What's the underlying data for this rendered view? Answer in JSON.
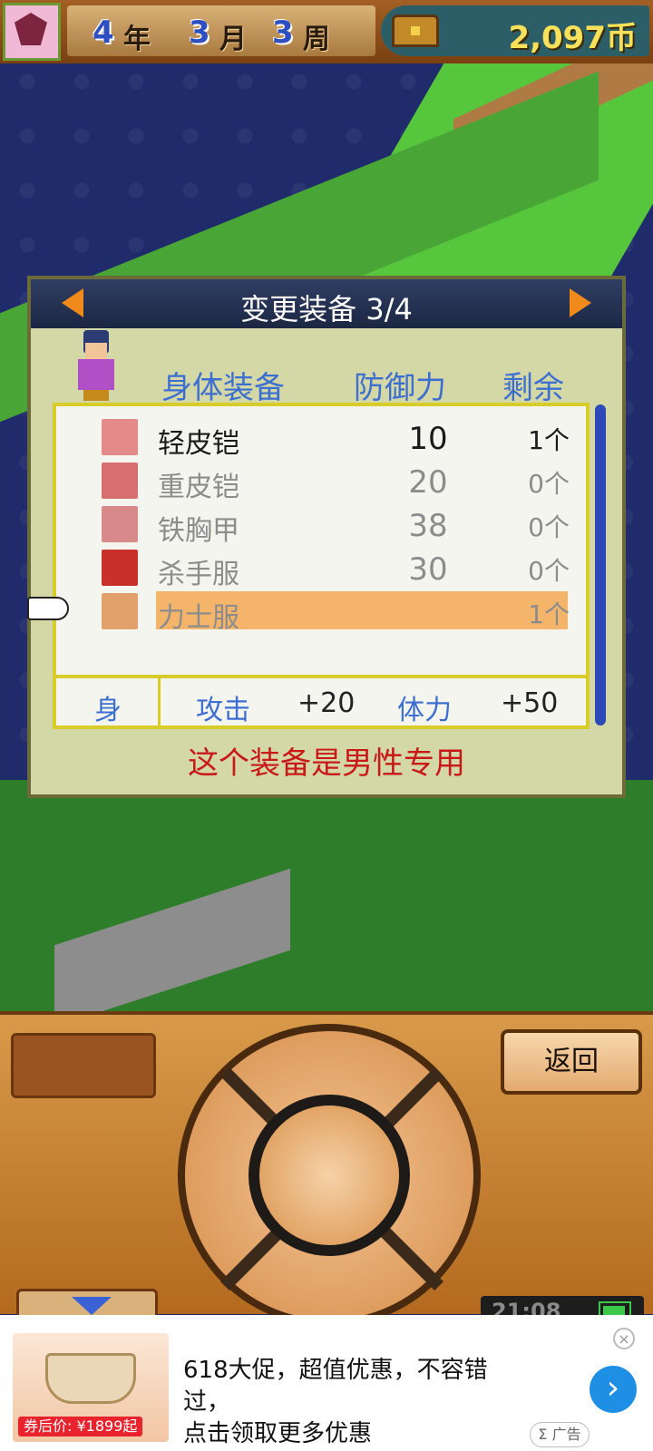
{
  "header": {
    "year": "4",
    "year_unit": "年",
    "month": "3",
    "month_unit": "月",
    "week": "3",
    "week_unit": "周",
    "coins": "2,097币"
  },
  "dialog": {
    "title": "变更装备 3/4",
    "columns": {
      "slot": "身体装备",
      "defense": "防御力",
      "remaining": "剩余"
    },
    "items": [
      {
        "name": "轻皮铠",
        "defense": "10",
        "count": "1个",
        "icon": "light-leather-armor-icon",
        "state": "available"
      },
      {
        "name": "重皮铠",
        "defense": "20",
        "count": "0个",
        "icon": "heavy-leather-armor-icon",
        "state": "unavailable"
      },
      {
        "name": "铁胸甲",
        "defense": "38",
        "count": "0个",
        "icon": "iron-breastplate-icon",
        "state": "unavailable"
      },
      {
        "name": "杀手服",
        "defense": "30",
        "count": "0个",
        "icon": "assassin-outfit-icon",
        "state": "unavailable"
      },
      {
        "name": "力士服",
        "defense": "",
        "count": "1个",
        "icon": "strongman-outfit-icon",
        "state": "selected"
      }
    ],
    "stats": {
      "slot": "身",
      "stat1_label": "攻击",
      "stat1_value": "+20",
      "stat2_label": "体力",
      "stat2_value": "+50"
    },
    "notice": "这个装备是男性专用"
  },
  "controls": {
    "back_label": "返回",
    "clock": "21:08"
  },
  "ad": {
    "line1": "618大促，超值优惠，不容错过，",
    "line2": "点击领取更多优惠",
    "price": "券后价: ¥1899起",
    "tag": "Σ 广告",
    "go": "›",
    "close": "×"
  },
  "colors": {
    "accent_blue": "#3d6fd0",
    "notice_red": "#c81818",
    "highlight": "#f4b56a",
    "coin_yellow": "#f7e15a"
  }
}
